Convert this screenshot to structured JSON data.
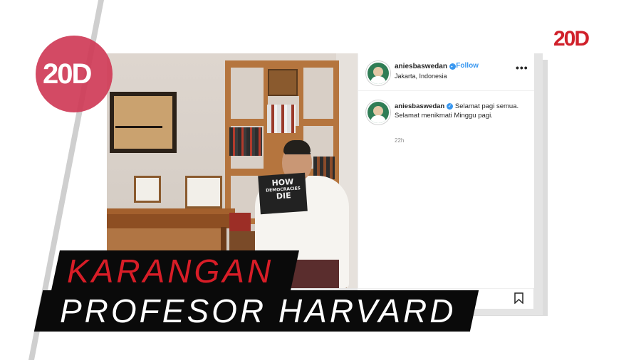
{
  "branding": {
    "logo_text": "20D",
    "logo_small_text": "20D"
  },
  "post": {
    "username": "aniesbaswedan",
    "verified_icon": "verified-badge-icon",
    "follow_separator": "•",
    "follow_label": "Follow",
    "location": "Jakarta, Indonesia",
    "more_label": "•••",
    "caption_username": "aniesbaswedan",
    "caption_text": "Selamat pagi semua. Selamat menikmati Minggu pagi.",
    "time": "22h"
  },
  "photo": {
    "book_title_line1": "HOW",
    "book_title_line2": "DEMOCRACIES",
    "book_title_line3": "DIE"
  },
  "headline": {
    "line1": "KARANGAN",
    "line2": "PROFESOR HARVARD"
  },
  "colors": {
    "accent_red": "#d81d27",
    "logo_pink": "#cf3b57",
    "instagram_blue": "#3897f0"
  }
}
